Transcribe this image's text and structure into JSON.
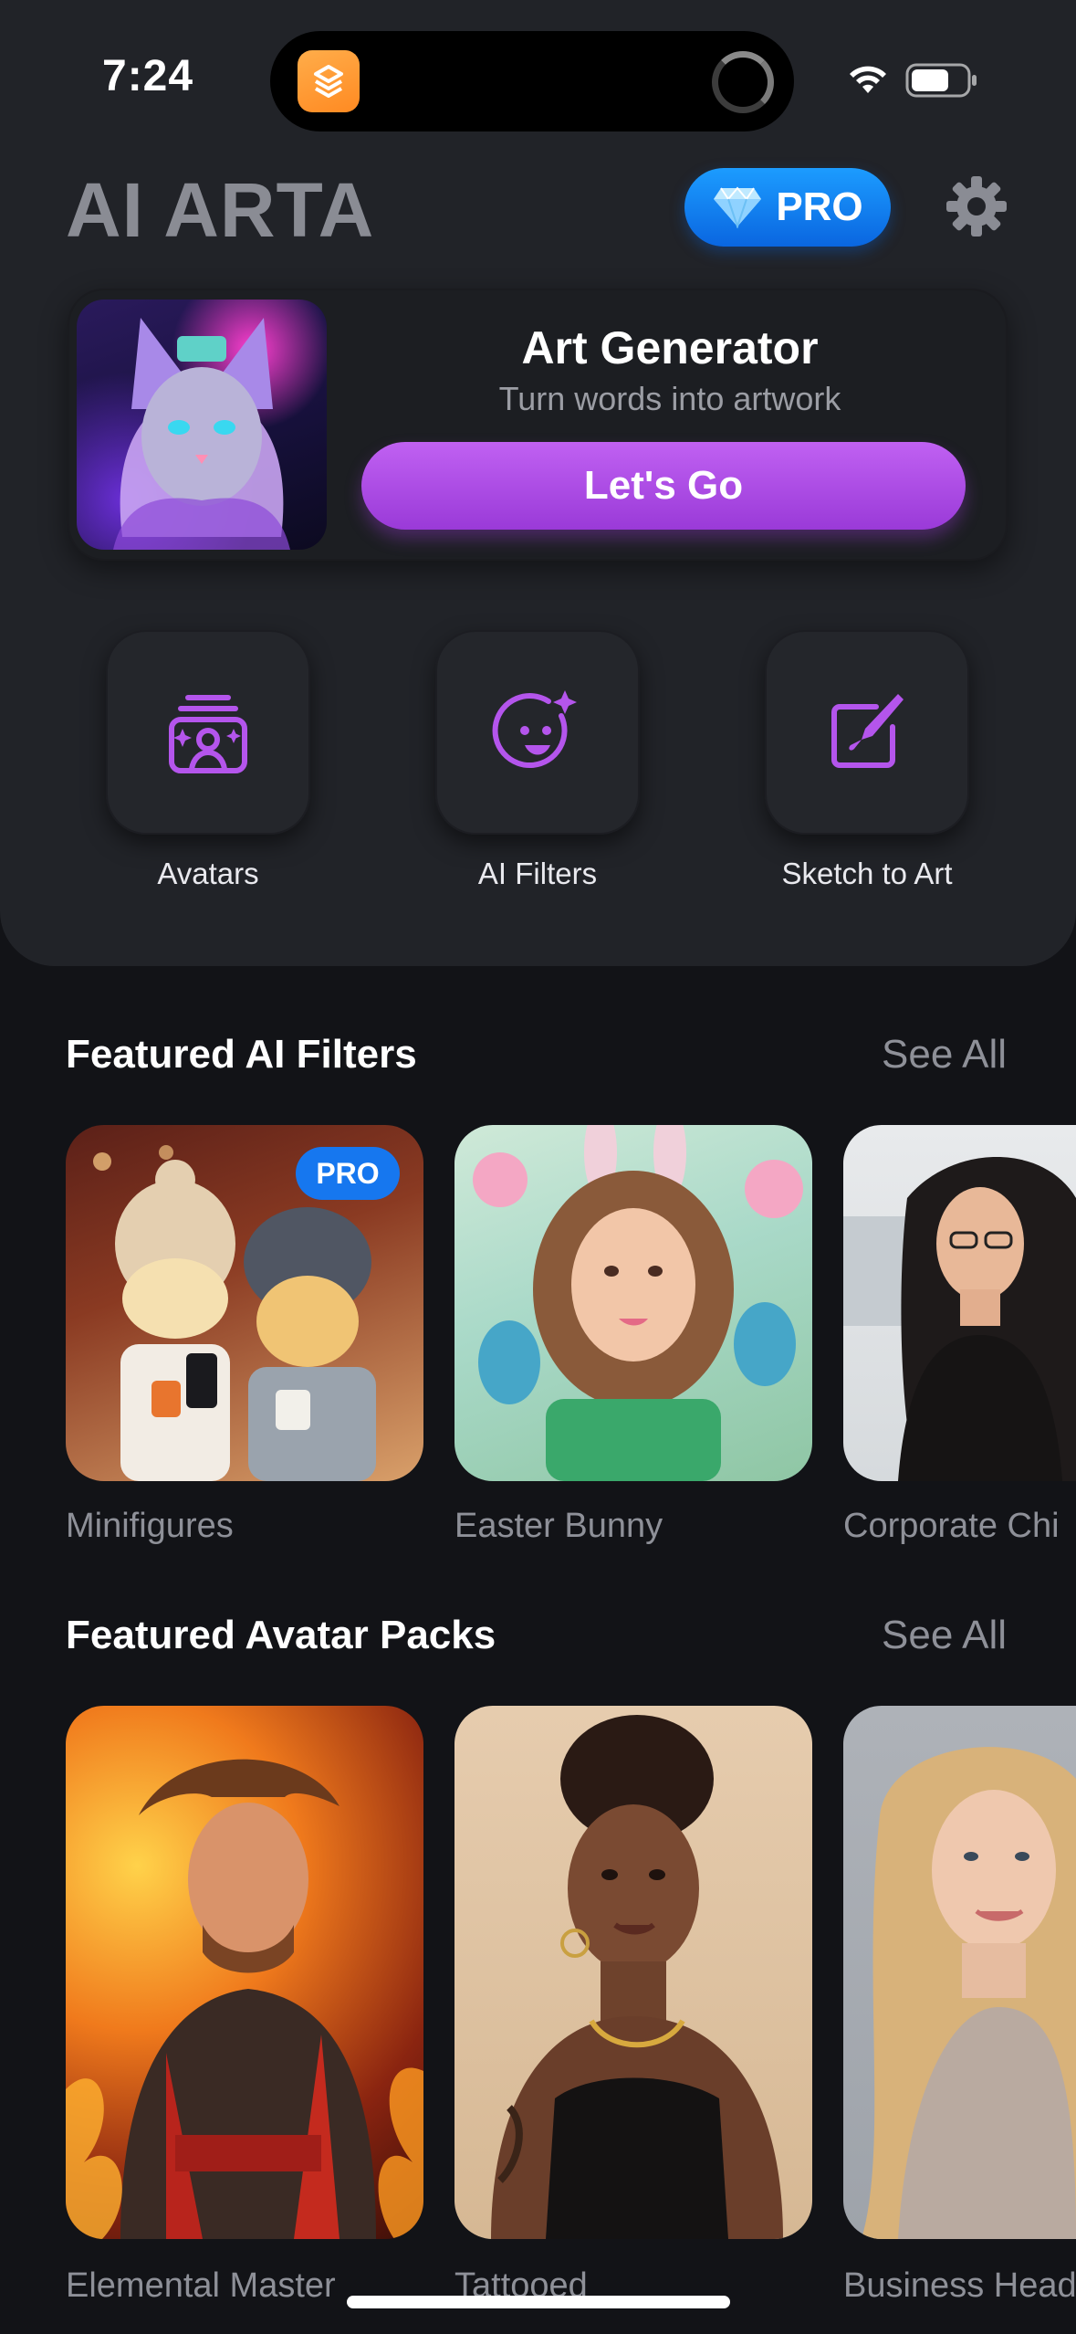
{
  "status_bar": {
    "time": "7:24",
    "icons": [
      "wifi-icon",
      "battery-icon"
    ]
  },
  "header": {
    "title": "AI ARTA",
    "pro_label": "PRO",
    "settings_icon": "gear-icon"
  },
  "art_generator": {
    "title": "Art Generator",
    "subtitle": "Turn words into artwork",
    "button_label": "Let's Go"
  },
  "features": [
    {
      "label": "Avatars",
      "icon": "avatars-icon"
    },
    {
      "label": "AI Filters",
      "icon": "ai-filters-icon"
    },
    {
      "label": "Sketch to Art",
      "icon": "sketch-to-art-icon"
    }
  ],
  "featured_filters": {
    "title": "Featured AI Filters",
    "see_all": "See All",
    "items": [
      {
        "label": "Minifigures",
        "badge": "PRO"
      },
      {
        "label": "Easter Bunny"
      },
      {
        "label": "Corporate Chi"
      }
    ]
  },
  "featured_avatars": {
    "title": "Featured Avatar Packs",
    "see_all": "See All",
    "items": [
      {
        "label": "Elemental Master"
      },
      {
        "label": "Tattooed"
      },
      {
        "label": "Business Head"
      }
    ]
  },
  "colors": {
    "accent_purple": "#b455ec",
    "pro_blue": "#1677ef",
    "background": "#121317",
    "panel": "#212328"
  }
}
